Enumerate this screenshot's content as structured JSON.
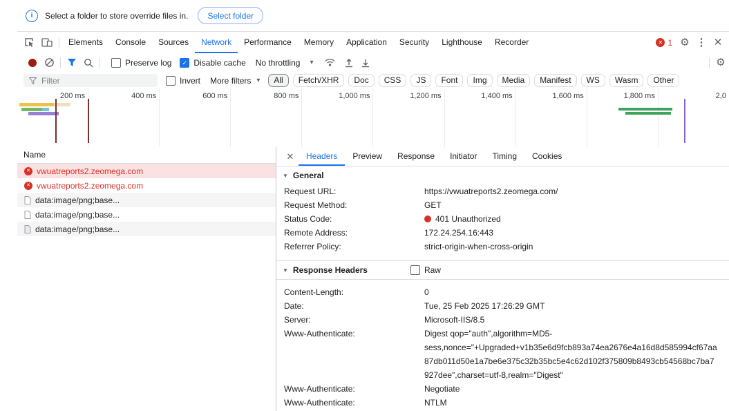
{
  "colors": {
    "accent": "#1a73e8",
    "error_red": "#d93025",
    "selected_row_bg": "#fbe2e2"
  },
  "infobar": {
    "message": "Select a folder to store override files in.",
    "button_label": "Select folder"
  },
  "main_tabs": {
    "items": [
      "Elements",
      "Console",
      "Sources",
      "Network",
      "Performance",
      "Memory",
      "Application",
      "Security",
      "Lighthouse",
      "Recorder"
    ],
    "active": "Network",
    "error_count": "1"
  },
  "toolbar": {
    "preserve_log_label": "Preserve log",
    "disable_cache_label": "Disable cache",
    "throttling_value": "No throttling"
  },
  "filter_bar": {
    "filter_placeholder": "Filter",
    "invert_label": "Invert",
    "more_filters_label": "More filters",
    "chips": [
      "All",
      "Fetch/XHR",
      "Doc",
      "CSS",
      "JS",
      "Font",
      "Img",
      "Media",
      "Manifest",
      "WS",
      "Wasm",
      "Other"
    ],
    "active_chip": "All"
  },
  "timeline": {
    "labels": [
      "200 ms",
      "400 ms",
      "600 ms",
      "800 ms",
      "1,000 ms",
      "1,200 ms",
      "1,400 ms",
      "1,600 ms",
      "1,800 ms",
      "2,0"
    ]
  },
  "requests": {
    "name_header": "Name",
    "rows": [
      {
        "name": "vwuatreports2.zeomega.com"
      },
      {
        "name": "vwuatreports2.zeomega.com"
      },
      {
        "name": "data:image/png;base..."
      },
      {
        "name": "data:image/png;base..."
      },
      {
        "name": "data:image/png;base..."
      }
    ]
  },
  "details": {
    "tabs": [
      "Headers",
      "Preview",
      "Response",
      "Initiator",
      "Timing",
      "Cookies"
    ],
    "active_tab": "Headers",
    "general_title": "General",
    "general_rows": [
      {
        "key": "Request URL:",
        "value": "https://vwuatreports2.zeomega.com/"
      },
      {
        "key": "Request Method:",
        "value": "GET"
      },
      {
        "key": "Status Code:",
        "value": "401 Unauthorized"
      },
      {
        "key": "Remote Address:",
        "value": "172.24.254.16:443"
      },
      {
        "key": "Referrer Policy:",
        "value": "strict-origin-when-cross-origin"
      }
    ],
    "response_headers_title": "Response Headers",
    "raw_label": "Raw",
    "response_rows": [
      {
        "key": "Content-Length:",
        "value": "0"
      },
      {
        "key": "Date:",
        "value": "Tue, 25 Feb 2025 17:26:29 GMT"
      },
      {
        "key": "Server:",
        "value": "Microsoft-IIS/8.5"
      },
      {
        "key": "Www-Authenticate:",
        "value": "Digest qop=\"auth\",algorithm=MD5-sess,nonce=\"+Upgraded+v1b35e6d9fcb893a74ea2676e4a16d8d585994cf67aa87db011d50e1a7be6e375c32b35bc5e4c62d102f375809b8493cb54568bc7ba7927dee\",charset=utf-8,realm=\"Digest\""
      },
      {
        "key": "Www-Authenticate:",
        "value": "Negotiate"
      },
      {
        "key": "Www-Authenticate:",
        "value": "NTLM"
      }
    ]
  },
  "icons": {
    "settings": "⚙",
    "more": "⋮",
    "close": "✕",
    "panel_close": "✕",
    "collapse": "▼",
    "dropdown": "▾",
    "check": "✓",
    "error_x": "✕",
    "info": "i"
  }
}
